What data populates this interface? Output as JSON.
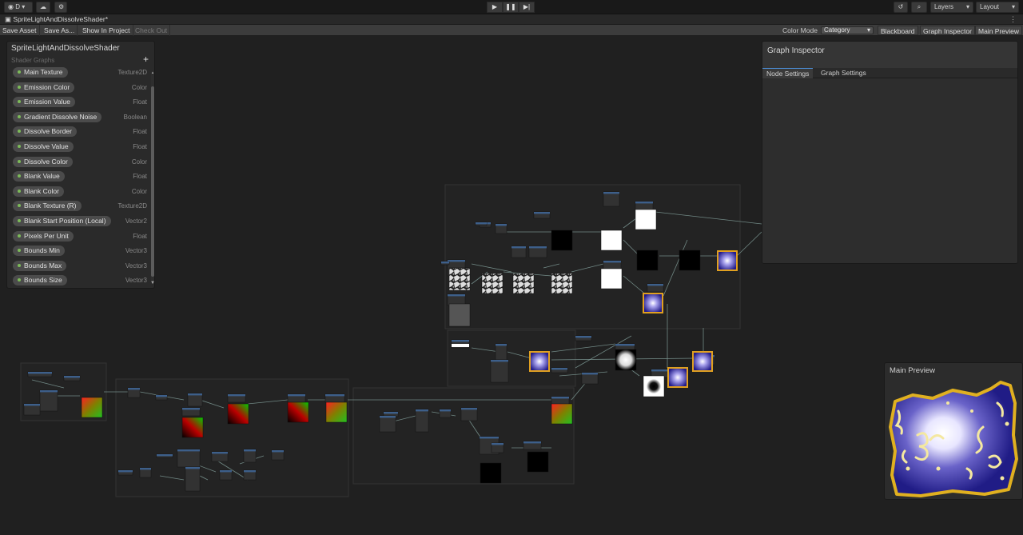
{
  "topbar": {
    "account_label": "D",
    "play_icon": "play-icon",
    "pause_icon": "pause-icon",
    "step_icon": "step-icon",
    "layers_label": "Layers",
    "layout_label": "Layout"
  },
  "tab": {
    "title": "SpriteLightAndDissolveShader*",
    "menu_glyph": "⋮"
  },
  "toolbar": {
    "save_asset": "Save Asset",
    "save_as": "Save As...",
    "show_in_project": "Show In Project",
    "check_out": "Check Out",
    "color_mode_label": "Color Mode",
    "color_mode_value": "Category",
    "blackboard": "Blackboard",
    "graph_inspector": "Graph Inspector",
    "main_preview": "Main Preview"
  },
  "blackboard": {
    "title": "SpriteLightAndDissolveShader",
    "subtitle": "Shader Graphs",
    "add_glyph": "+",
    "properties": [
      {
        "name": "Main Texture",
        "type": "Texture2D"
      },
      {
        "name": "Emission Color",
        "type": "Color"
      },
      {
        "name": "Emission Value",
        "type": "Float"
      },
      {
        "name": "Gradient Dissolve Noise",
        "type": "Boolean"
      },
      {
        "name": "Dissolve Border",
        "type": "Float"
      },
      {
        "name": "Dissolve Value",
        "type": "Float"
      },
      {
        "name": "Dissolve Color",
        "type": "Color"
      },
      {
        "name": "Blank Value",
        "type": "Float"
      },
      {
        "name": "Blank Color",
        "type": "Color"
      },
      {
        "name": "Blank Texture (R)",
        "type": "Texture2D"
      },
      {
        "name": "Blank Start Position (Local)",
        "type": "Vector2"
      },
      {
        "name": "Pixels Per Unit",
        "type": "Float"
      },
      {
        "name": "Bounds Min",
        "type": "Vector3"
      },
      {
        "name": "Bounds Max",
        "type": "Vector3"
      },
      {
        "name": "Bounds Size",
        "type": "Vector3"
      }
    ]
  },
  "inspector": {
    "title": "Graph Inspector",
    "tabs": [
      "Node Settings",
      "Graph Settings"
    ]
  },
  "preview": {
    "title": "Main Preview"
  },
  "colors": {
    "accent": "#4c8ed6",
    "node_header": "#3d5f8a",
    "wire": "#7f9b97"
  }
}
